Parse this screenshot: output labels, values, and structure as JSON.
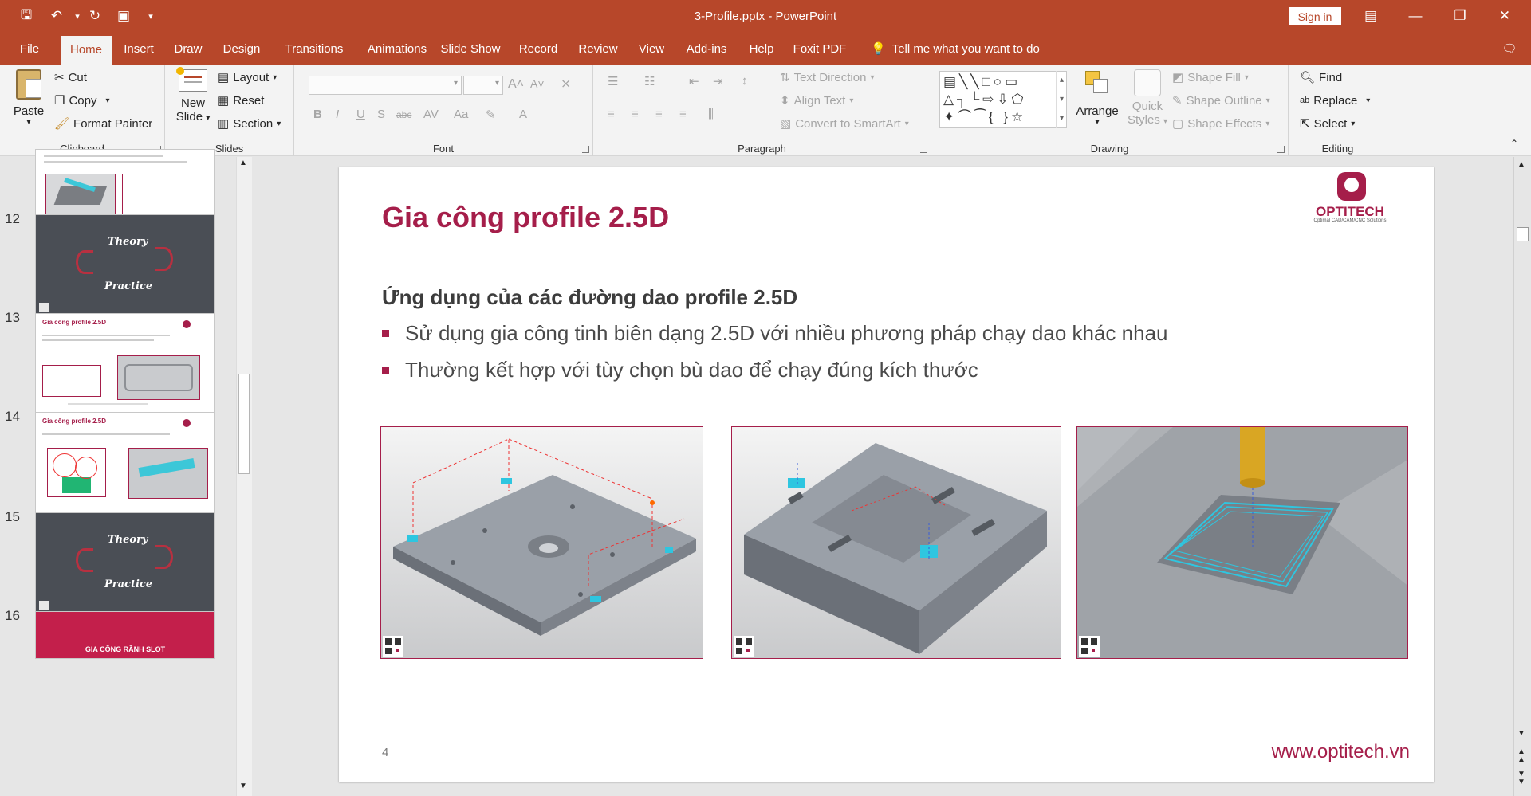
{
  "window": {
    "doc_title": "3-Profile.pptx  -  PowerPoint",
    "sign_in": "Sign in"
  },
  "tabs": [
    "File",
    "Home",
    "Insert",
    "Draw",
    "Design",
    "Transitions",
    "Animations",
    "Slide Show",
    "Record",
    "Review",
    "View",
    "Add-ins",
    "Help",
    "Foxit PDF"
  ],
  "tell_me": "Tell me what you want to do",
  "ribbon": {
    "clipboard": {
      "label": "Clipboard",
      "paste": "Paste",
      "cut": "Cut",
      "copy": "Copy",
      "format_painter": "Format Painter"
    },
    "slides": {
      "label": "Slides",
      "new_slide_1": "New",
      "new_slide_2": "Slide",
      "layout": "Layout",
      "reset": "Reset",
      "section": "Section"
    },
    "font": {
      "label": "Font"
    },
    "paragraph": {
      "label": "Paragraph",
      "text_direction": "Text Direction",
      "align_text": "Align Text",
      "smartart": "Convert to SmartArt"
    },
    "drawing": {
      "label": "Drawing",
      "arrange": "Arrange",
      "quick_styles_1": "Quick",
      "quick_styles_2": "Styles",
      "shape_fill": "Shape Fill",
      "shape_outline": "Shape Outline",
      "shape_effects": "Shape Effects"
    },
    "editing": {
      "label": "Editing",
      "find": "Find",
      "replace": "Replace",
      "select": "Select"
    }
  },
  "thumbnails": [
    {
      "num": "",
      "kind": "content",
      "title": ""
    },
    {
      "num": "12",
      "kind": "dark",
      "text1": "Theory",
      "text2": "Practice"
    },
    {
      "num": "13",
      "kind": "content",
      "title": "Gia công profile 2.5D"
    },
    {
      "num": "14",
      "kind": "content",
      "title": "Gia công profile 2.5D"
    },
    {
      "num": "15",
      "kind": "dark",
      "text1": "Theory",
      "text2": "Practice"
    },
    {
      "num": "16",
      "kind": "red",
      "text1": "GIA CÔNG RÃNH SLOT"
    }
  ],
  "slide": {
    "title": "Gia công profile 2.5D",
    "logo_text": "OPTITECH",
    "logo_tagline": "Optimal CAD/CAM/CNC Solutions",
    "subheading": "Ứng dụng của các đường dao profile 2.5D",
    "bullets": [
      "Sử dụng gia công tinh biên dạng 2.5D với nhiều phương pháp chạy dao khác nhau",
      "Thường kết hợp với tùy chọn bù dao để chạy đúng kích thước"
    ],
    "page_number": "4",
    "website": "www.optitech.vn"
  },
  "colors": {
    "brand": "#b7472a",
    "accent": "#a51e4a",
    "toolpath": "#00c8e8"
  }
}
